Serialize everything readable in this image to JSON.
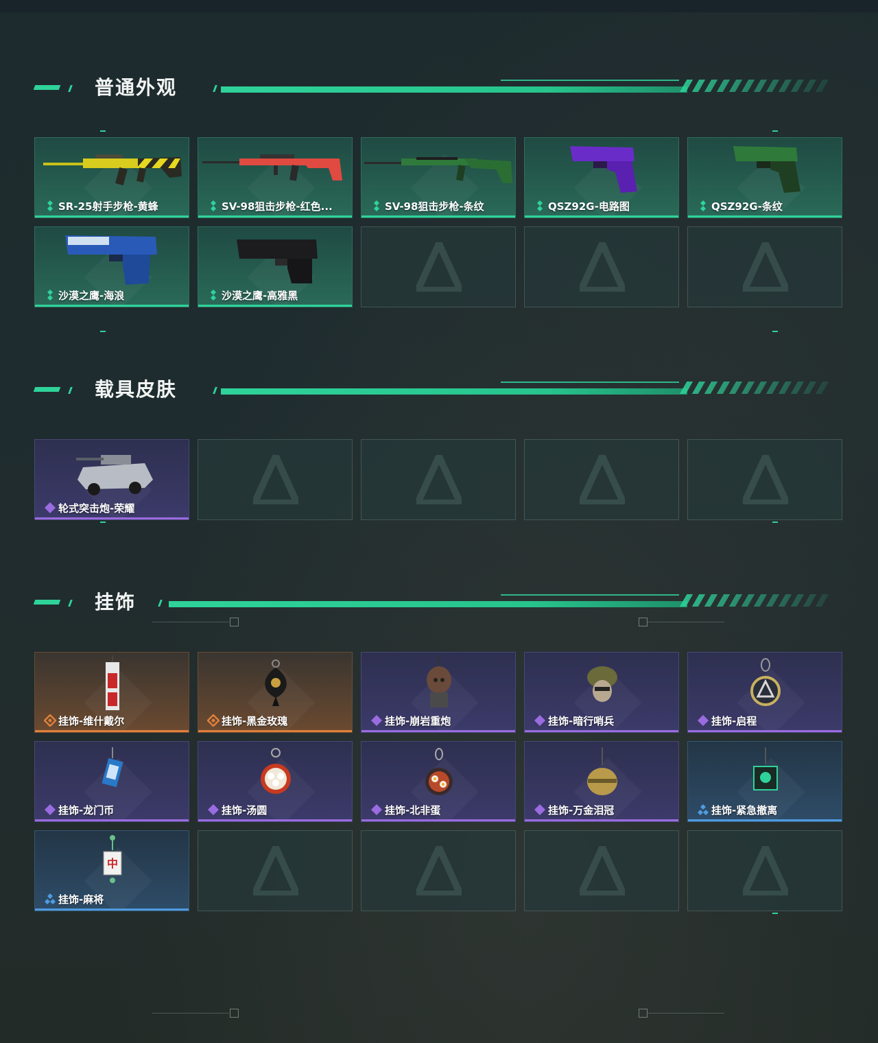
{
  "sections": [
    {
      "title": "普通外观",
      "items": [
        {
          "label": "SR-25射手步枪-黄蜂",
          "rarity": "green",
          "icon": "rifle-yellow"
        },
        {
          "label": "SV-98狙击步枪-红色...",
          "rarity": "green",
          "icon": "sniper-red"
        },
        {
          "label": "SV-98狙击步枪-条纹",
          "rarity": "green",
          "icon": "sniper-green"
        },
        {
          "label": "QSZ92G-电路图",
          "rarity": "green",
          "icon": "pistol-purple"
        },
        {
          "label": "QSZ92G-条纹",
          "rarity": "green",
          "icon": "pistol-green"
        },
        {
          "label": "沙漠之鹰-海浪",
          "rarity": "green",
          "icon": "deagle-blue"
        },
        {
          "label": "沙漠之鹰-高雅黑",
          "rarity": "green",
          "icon": "deagle-black"
        }
      ]
    },
    {
      "title": "载具皮肤",
      "items": [
        {
          "label": "轮式突击炮-荣耀",
          "rarity": "purple",
          "icon": "armored-vehicle"
        }
      ]
    },
    {
      "title": "挂饰",
      "items": [
        {
          "label": "挂饰-维什戴尔",
          "rarity": "orange",
          "icon": "charm-tag"
        },
        {
          "label": "挂饰-黑金玫瑰",
          "rarity": "orange",
          "icon": "charm-rose"
        },
        {
          "label": "挂饰-崩岩重炮",
          "rarity": "purple",
          "icon": "charm-figure"
        },
        {
          "label": "挂饰-暗行哨兵",
          "rarity": "purple",
          "icon": "charm-helmet"
        },
        {
          "label": "挂饰-启程",
          "rarity": "purple",
          "icon": "charm-ring"
        },
        {
          "label": "挂饰-龙门币",
          "rarity": "purple",
          "icon": "charm-card"
        },
        {
          "label": "挂饰-汤圆",
          "rarity": "purple",
          "icon": "charm-bowl"
        },
        {
          "label": "挂饰-北非蛋",
          "rarity": "purple",
          "icon": "charm-pan"
        },
        {
          "label": "挂饰-万金泪冠",
          "rarity": "purple",
          "icon": "charm-crown"
        },
        {
          "label": "挂饰-紧急撤离",
          "rarity": "blue",
          "icon": "charm-cube"
        },
        {
          "label": "挂饰-麻将",
          "rarity": "blue",
          "icon": "charm-mahjong"
        }
      ]
    }
  ],
  "colors": {
    "accent": "#2fd39a",
    "green": "#2fd39a",
    "purple": "#9a6ce0",
    "orange": "#e07f3c",
    "blue": "#4f9be0"
  }
}
